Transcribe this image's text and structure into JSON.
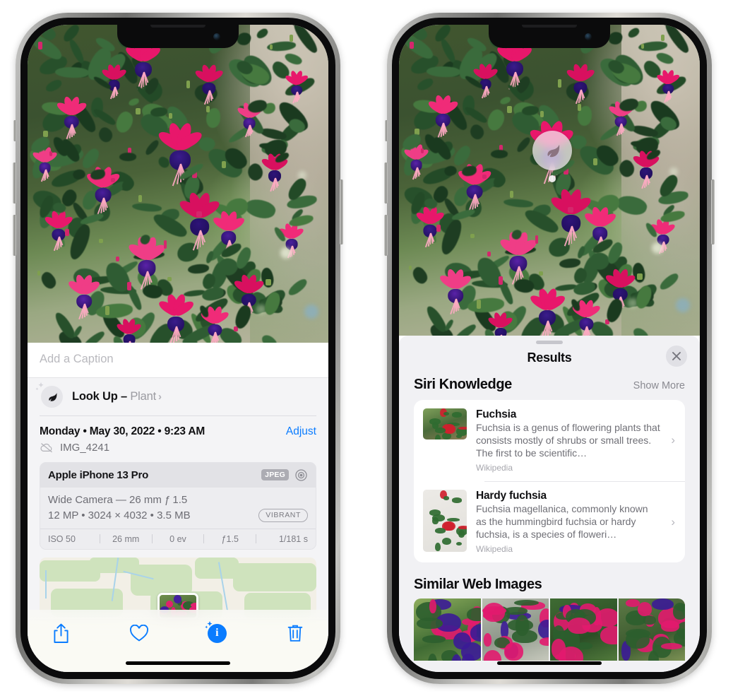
{
  "left_phone": {
    "caption_placeholder": "Add a Caption",
    "lookup": {
      "label": "Look Up – ",
      "subject": "Plant",
      "chevron": "›",
      "icon": "leaf-icon"
    },
    "meta": {
      "date_line": "Monday • May 30, 2022 • 9:23 AM",
      "adjust_label": "Adjust",
      "filename": "IMG_4241",
      "cloud_icon": "cloud-slash-icon"
    },
    "camera_card": {
      "model": "Apple iPhone 13 Pro",
      "format_tag": "JPEG",
      "aperture_icon": "aperture-icon",
      "lens_line": "Wide Camera — 26 mm ƒ 1.5",
      "size_line": "12 MP • 3024 × 4032 • 3.5 MB",
      "style_pill": "VIBRANT",
      "exif": [
        "ISO 50",
        "26 mm",
        "0 ev",
        "ƒ1.5",
        "1/181 s"
      ]
    },
    "toolbar": [
      {
        "name": "share-button",
        "icon": "share-icon"
      },
      {
        "name": "favorite-button",
        "icon": "heart-icon"
      },
      {
        "name": "info-button",
        "icon": "info-sparkle-icon",
        "glyph": "i"
      },
      {
        "name": "delete-button",
        "icon": "trash-icon"
      }
    ]
  },
  "right_phone": {
    "visual_lookup_badge": {
      "icon": "leaf-icon"
    },
    "sheet": {
      "title": "Results",
      "close_icon": "close-icon",
      "sections": [
        {
          "title": "Siri Knowledge",
          "action": "Show More",
          "items": [
            {
              "name": "Fuchsia",
              "description": "Fuchsia is a genus of flowering plants that consists mostly of shrubs or small trees. The first to be scientific…",
              "source": "Wikipedia",
              "chevron": "›"
            },
            {
              "name": "Hardy fuchsia",
              "description": "Fuchsia magellanica, commonly known as the hummingbird fuchsia or hardy fuchsia, is a species of floweri…",
              "source": "Wikipedia",
              "chevron": "›"
            }
          ]
        },
        {
          "title": "Similar Web Images",
          "action": "",
          "images": 4
        }
      ]
    }
  },
  "colors": {
    "accent_blue": "#0a7cff",
    "sheet_bg": "#f1f1f4",
    "card_bg": "#ffffff"
  }
}
